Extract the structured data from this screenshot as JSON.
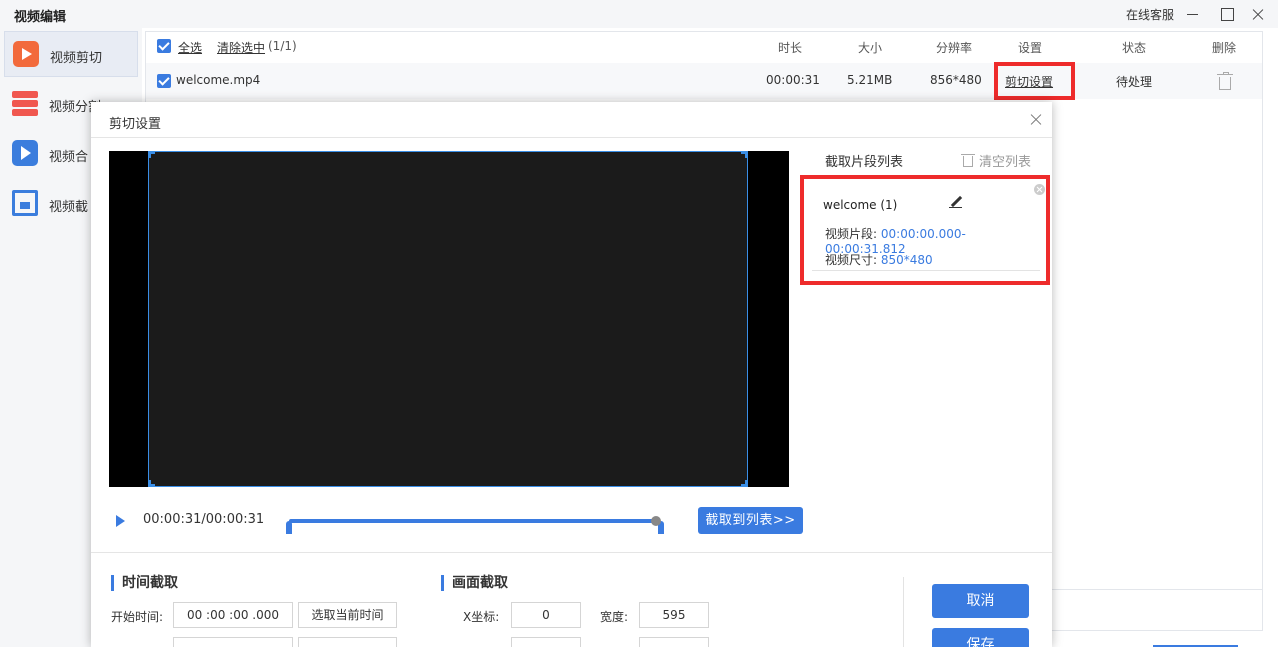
{
  "app": {
    "title": "视频编辑",
    "service_link": "在线客服"
  },
  "sidebar": {
    "items": [
      {
        "label": "视频剪切",
        "icon": "video-cut-icon",
        "active": true
      },
      {
        "label": "视频分割",
        "icon": "video-split-icon"
      },
      {
        "label": "视频合",
        "icon": "video-merge-icon"
      },
      {
        "label": "视频截",
        "icon": "video-crop-icon"
      }
    ]
  },
  "list": {
    "select_all": "全选",
    "clear_selection": "清除选中",
    "selection_count": "(1/1)",
    "columns": {
      "duration": "时长",
      "size": "大小",
      "resolution": "分辨率",
      "settings": "设置",
      "status": "状态",
      "delete": "删除"
    },
    "rows": [
      {
        "name": "welcome.mp4",
        "duration": "00:00:31",
        "size": "5.21MB",
        "resolution": "856*480",
        "settings_link": "剪切设置",
        "status": "待处理"
      }
    ]
  },
  "dialog": {
    "title": "剪切设置",
    "player": {
      "time": "00:00:31/00:00:31"
    },
    "add_to_list": "截取到列表>>",
    "segments": {
      "header": "截取片段列表",
      "clear_all": "清空列表",
      "items": [
        {
          "name": "welcome (1)",
          "segment_label": "视频片段:",
          "segment_value": "00:00:00.000-00:00:31.812",
          "size_label": "视频尺寸:",
          "size_value": "850*480"
        }
      ]
    },
    "time_cut": {
      "title": "时间截取",
      "start_label": "开始时间:",
      "start_value": "00 :00 :00 .000",
      "pick_current": "选取当前时间"
    },
    "frame_cut": {
      "title": "画面截取",
      "x_label": "X坐标:",
      "x_value": "0",
      "width_label": "宽度:",
      "width_value": "595"
    },
    "cancel": "取消",
    "save": "保存"
  },
  "colors": {
    "accent": "#3a7be0",
    "highlight": "#ee2b2b"
  }
}
